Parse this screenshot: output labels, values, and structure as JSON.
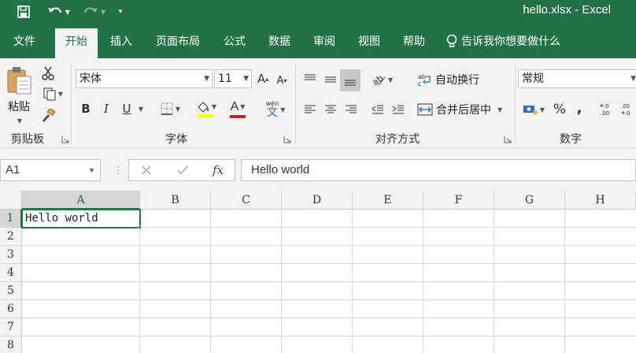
{
  "window": {
    "title": "hello.xlsx  -  Excel"
  },
  "tabs": [
    "文件",
    "开始",
    "插入",
    "页面布局",
    "公式",
    "数据",
    "审阅",
    "视图",
    "帮助"
  ],
  "tell_me": "告诉我你想要做什么",
  "ribbon": {
    "clipboard": {
      "paste_label": "粘贴",
      "group_label": "剪贴板"
    },
    "font": {
      "font_name": "宋体",
      "font_size": "11",
      "group_label": "字体",
      "bold": "B",
      "italic": "I",
      "underline": "U",
      "font_color_letter": "A",
      "pinyin_top": "wén",
      "pinyin_bottom": "文"
    },
    "alignment": {
      "wrap_text": "自动换行",
      "merge_center": "合并后居中",
      "group_label": "对齐方式"
    },
    "number": {
      "format": "常规",
      "group_label": "数字",
      "percent": "%",
      "comma": ","
    }
  },
  "formula_bar": {
    "name_box": "A1",
    "fx": "fx",
    "value": "Hello world"
  },
  "grid": {
    "columns": [
      "A",
      "B",
      "C",
      "D",
      "E",
      "F",
      "G",
      "H"
    ],
    "rows": [
      "1",
      "2",
      "3",
      "4",
      "5",
      "6",
      "7",
      "8"
    ],
    "a1_value": "Hello world"
  },
  "colors": {
    "brand": "#217346",
    "font_color_bar": "#e81123",
    "fill_color_bar": "#ffff00"
  }
}
